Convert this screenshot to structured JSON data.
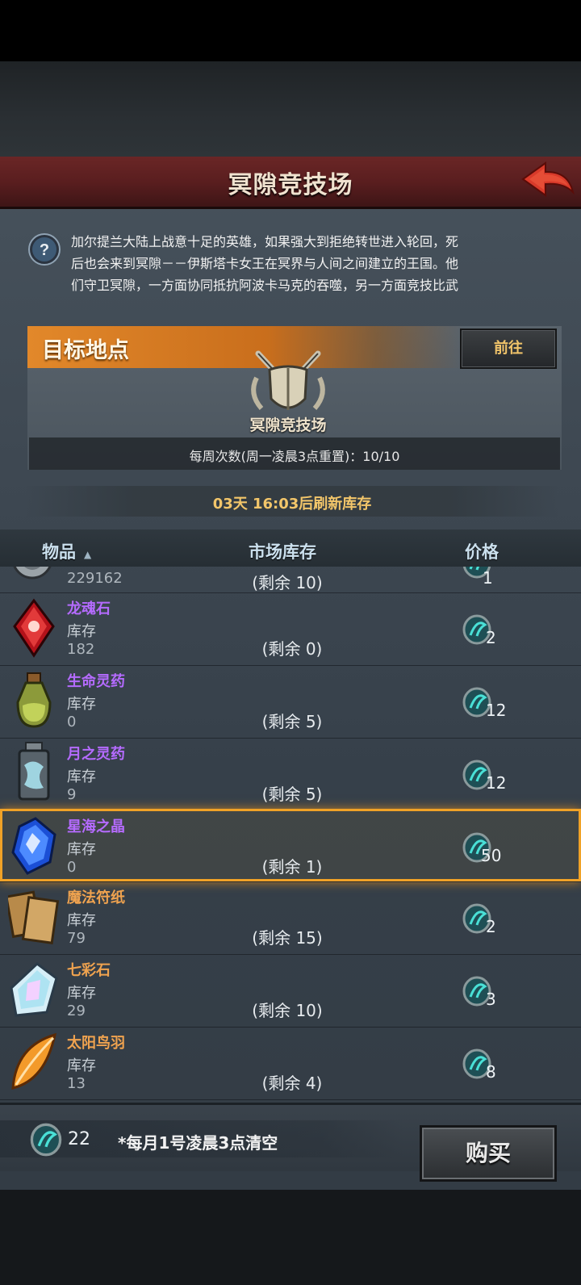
{
  "header": {
    "title": "冥隙竞技场"
  },
  "intro": {
    "lines": [
      "加尔提兰大陆上战意十足的英雄，如果强大到拒绝转世进入轮回，死",
      "后也会来到冥隙－－伊斯塔卡女王在冥界与人间之间建立的王国。他",
      "们守卫冥隙，一方面协同抵抗阿波卡马克的吞噬，另一方面竞技比武"
    ]
  },
  "target": {
    "label": "目标地点",
    "goto_label": "前往",
    "location_name": "冥隙竞技场",
    "weekly_count": "每周次数(周一凌晨3点重置)：10/10"
  },
  "refresh": {
    "text": "03天 16:03后刷新库存"
  },
  "table": {
    "col_item": "物品",
    "sort_glyph": "▲",
    "col_stock": "市场库存",
    "col_price": "价格"
  },
  "partial_row": {
    "stock": "229162",
    "remain": "(剩余 10)",
    "price": "1"
  },
  "items": [
    {
      "name": "龙魂石",
      "stock_label": "库存",
      "stock": "182",
      "remain": "(剩余 0)",
      "price": "2",
      "name_color": "purple",
      "icon": "red-gem-icon"
    },
    {
      "name": "生命灵药",
      "stock_label": "库存",
      "stock": "0",
      "remain": "(剩余 5)",
      "price": "12",
      "name_color": "purple",
      "icon": "green-potion-icon"
    },
    {
      "name": "月之灵药",
      "stock_label": "库存",
      "stock": "9",
      "remain": "(剩余 5)",
      "price": "12",
      "name_color": "purple",
      "icon": "silver-flask-icon"
    },
    {
      "name": "星海之晶",
      "stock_label": "库存",
      "stock": "0",
      "remain": "(剩余 1)",
      "price": "50",
      "name_color": "purple",
      "icon": "blue-crystal-icon"
    },
    {
      "name": "魔法符纸",
      "stock_label": "库存",
      "stock": "79",
      "remain": "(剩余 15)",
      "price": "2",
      "name_color": "orange",
      "icon": "paper-scroll-icon"
    },
    {
      "name": "七彩石",
      "stock_label": "库存",
      "stock": "29",
      "remain": "(剩余 10)",
      "price": "3",
      "name_color": "orange",
      "icon": "rainbow-stone-icon"
    },
    {
      "name": "太阳鸟羽",
      "stock_label": "库存",
      "stock": "13",
      "remain": "(剩余 4)",
      "price": "8",
      "name_color": "orange",
      "icon": "feather-icon"
    }
  ],
  "footer": {
    "coin_count": "22",
    "note": "*每月1号凌晨3点清空",
    "buy_label": "购买"
  },
  "colors": {
    "accent_orange": "#f0a227",
    "name_purple": "#b56bff",
    "name_orange": "#f0a34f",
    "header_red": "#5a1e1f",
    "coin_teal": "#2fc4c0"
  }
}
